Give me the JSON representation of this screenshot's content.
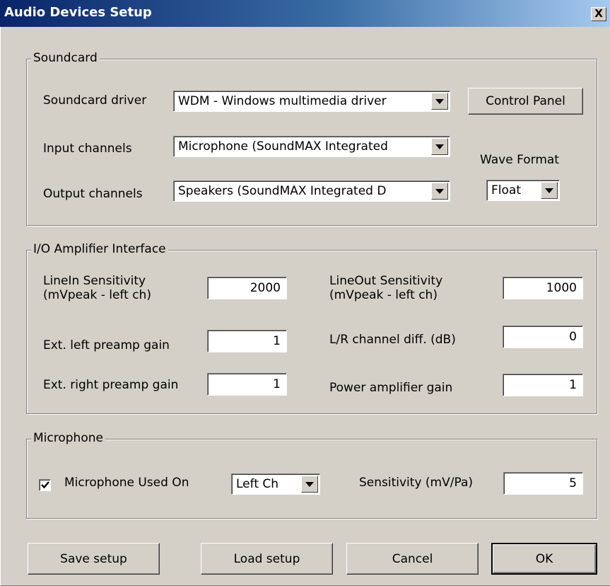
{
  "window": {
    "title": "Audio Devices Setup",
    "close": "X"
  },
  "soundcard": {
    "legend": "Soundcard",
    "driver_label": "Soundcard driver",
    "driver_value": "WDM - Windows multimedia driver",
    "control_panel": "Control Panel",
    "input_label": "Input channels",
    "input_value": "Microphone (SoundMAX Integrated",
    "output_label": "Output channels",
    "output_value": "Speakers (SoundMAX Integrated D",
    "wave_format_label": "Wave Format",
    "wave_format_value": "Float"
  },
  "io": {
    "legend": "I/O Amplifier Interface",
    "linein_label_1": "LineIn Sensitivity",
    "linein_label_2": "(mVpeak - left ch)",
    "linein_value": "2000",
    "lineout_label_1": "LineOut Sensitivity",
    "lineout_label_2": "(mVpeak - left ch)",
    "lineout_value": "1000",
    "left_preamp_label": "Ext. left preamp gain",
    "left_preamp_value": "1",
    "lr_diff_label": "L/R channel diff. (dB)",
    "lr_diff_value": "0",
    "right_preamp_label": "Ext. right preamp gain",
    "right_preamp_value": "1",
    "power_amp_label": "Power amplifier gain",
    "power_amp_value": "1"
  },
  "microphone": {
    "legend": "Microphone",
    "used_on_label": "Microphone Used On",
    "used_on_checked": true,
    "channel_value": "Left Ch",
    "sensitivity_label": "Sensitivity (mV/Pa)",
    "sensitivity_value": "5"
  },
  "buttons": {
    "save": "Save setup",
    "load": "Load setup",
    "cancel": "Cancel",
    "ok": "OK"
  }
}
